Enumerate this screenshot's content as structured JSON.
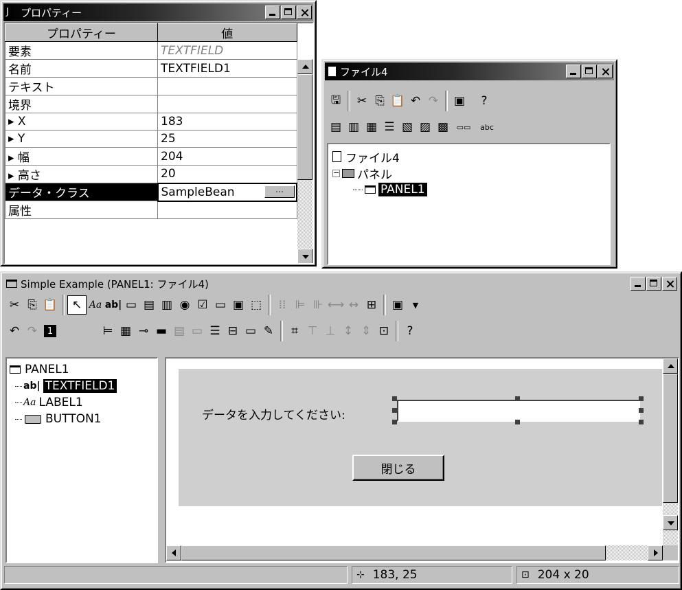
{
  "properties_window": {
    "title": "プロパティー",
    "col_property": "プロパティー",
    "col_value": "値",
    "rows": [
      {
        "name": "要素",
        "value": "TEXTFIELD",
        "italic": true
      },
      {
        "name": "名前",
        "value": "TEXTFIELD1"
      },
      {
        "name": "テキスト",
        "value": ""
      },
      {
        "name": "境界",
        "value": ""
      },
      {
        "name": "▸ X",
        "value": "183"
      },
      {
        "name": "▸ Y",
        "value": "25"
      },
      {
        "name": "▸ 幅",
        "value": "204"
      },
      {
        "name": "▸ 高さ",
        "value": "20"
      },
      {
        "name": "データ・クラス",
        "value": "SampleBean",
        "selected": true
      },
      {
        "name": "属性",
        "value": ""
      }
    ]
  },
  "file_window": {
    "title": "ファイル4",
    "tree": {
      "root": "ファイル4",
      "folder": "パネル",
      "panel": "PANEL1"
    }
  },
  "example_window": {
    "title": "Simple Example (PANEL1: ファイル4)",
    "tree": {
      "root": "PANEL1",
      "items": [
        "TEXTFIELD1",
        "LABEL1",
        "BUTTON1"
      ]
    },
    "canvas": {
      "label": "データを入力してください:",
      "textfield_value": "",
      "close_button": "閉じる"
    },
    "status": {
      "position": "183, 25",
      "size": "204 x 20"
    }
  },
  "colors": {
    "face": "#c0c0c0",
    "canvas_panel": "#cfcfcf",
    "selection": "#000000"
  }
}
